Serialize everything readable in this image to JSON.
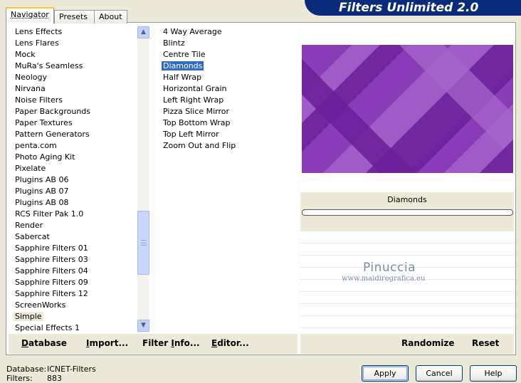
{
  "app": {
    "title": "Filters Unlimited 2.0",
    "banner_color": "#0A2A7A",
    "accent_tab": "#FFC83C",
    "selection_color": "#316AC5"
  },
  "tabs": [
    {
      "label": "Navigator",
      "active": true
    },
    {
      "label": "Presets",
      "active": false
    },
    {
      "label": "About",
      "active": false
    }
  ],
  "categories": {
    "items": [
      "Lens Effects",
      "Lens Flares",
      "Mock",
      "MuRa's Seamless",
      "Neology",
      "Nirvana",
      "Noise Filters",
      "Paper Backgrounds",
      "Paper Textures",
      "Pattern Generators",
      "penta.com",
      "Photo Aging Kit",
      "Pixelate",
      "Plugins AB 06",
      "Plugins AB 07",
      "Plugins AB 08",
      "RCS Filter Pak 1.0",
      "Render",
      "Sabercat",
      "Sapphire Filters 01",
      "Sapphire Filters 03",
      "Sapphire Filters 04",
      "Sapphire Filters 09",
      "Sapphire Filters 12",
      "ScreenWorks",
      "Simple",
      "Special Effects 1"
    ],
    "selected": "Simple"
  },
  "filters": {
    "items": [
      "4 Way Average",
      "Blintz",
      "Centre Tile",
      "Diamonds",
      "Half Wrap",
      "Horizontal Grain",
      "Left Right Wrap",
      "Pizza Slice Mirror",
      "Top Bottom Wrap",
      "Top Left Mirror",
      "Zoom Out and Flip"
    ],
    "selected": "Diamonds"
  },
  "preview": {
    "filter_name": "Diamonds",
    "colors": {
      "dark": "#6A1F9A",
      "mid": "#8A3CB8",
      "light": "#A666CC"
    },
    "watermark": "Pinuccia",
    "watermark_url": "www.maidiregrafica.eu"
  },
  "toolbar": {
    "database": {
      "u": "D",
      "rest": "atabase"
    },
    "import": {
      "u": "I",
      "rest": "mport..."
    },
    "filter_info": {
      "pre": "Filter ",
      "u": "I",
      "rest": "nfo..."
    },
    "editor": {
      "u": "E",
      "rest": "ditor..."
    },
    "randomize": "Randomize",
    "reset": "Reset"
  },
  "status": {
    "database_label": "Database:",
    "database_value": "ICNET-Filters",
    "filters_label": "Filters:",
    "filters_value": "883"
  },
  "dialog_buttons": {
    "apply": "Apply",
    "cancel": "Cancel",
    "help": "Help"
  },
  "icons": {
    "scroll_up": "▲",
    "scroll_down": "▼"
  }
}
